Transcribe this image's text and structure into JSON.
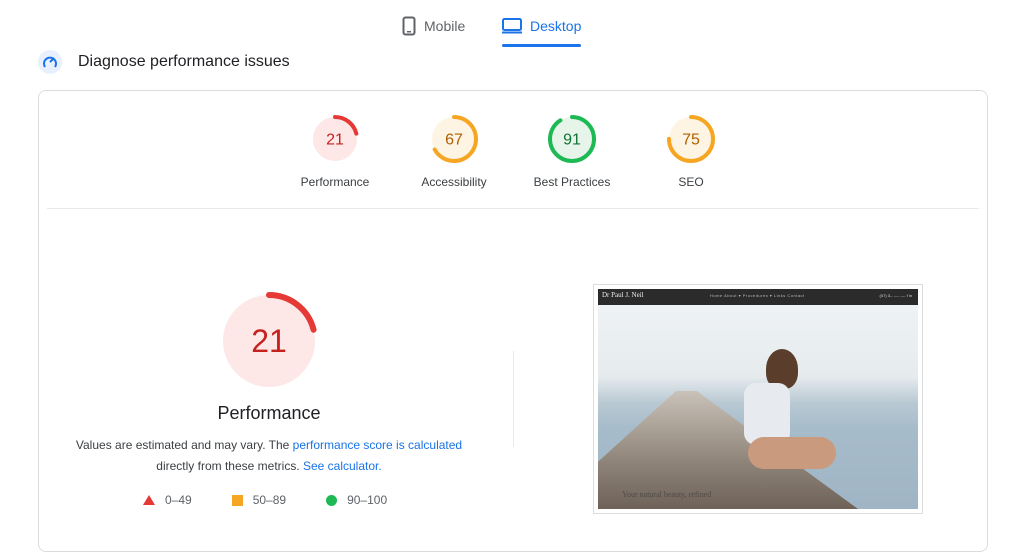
{
  "tabs": {
    "mobile_label": "Mobile",
    "desktop_label": "Desktop",
    "selected": "Desktop"
  },
  "section": {
    "title": "Diagnose performance issues"
  },
  "categories": [
    {
      "label": "Performance",
      "score": "21",
      "status": "fail",
      "color": "#e53935",
      "fill": "#fde7e7"
    },
    {
      "label": "Accessibility",
      "score": "67",
      "status": "average",
      "color": "#f6a623",
      "fill": "#fef4e3"
    },
    {
      "label": "Best Practices",
      "score": "91",
      "status": "pass",
      "color": "#1db954",
      "fill": "#e6f4ea"
    },
    {
      "label": "SEO",
      "score": "75",
      "status": "average",
      "color": "#f6a623",
      "fill": "#fef4e3"
    }
  ],
  "performance": {
    "score": "21",
    "title": "Performance",
    "desc_part1": "Values are estimated and may vary. The ",
    "desc_link1": "performance score is calculated",
    "desc_part2": "directly from these metrics. ",
    "desc_link2": "See calculator."
  },
  "legend": [
    {
      "range": "0–49",
      "shape": "triangle",
      "color": "#e53935"
    },
    {
      "range": "50–89",
      "shape": "square",
      "color": "#f6a623"
    },
    {
      "range": "90–100",
      "shape": "circle",
      "color": "#1db954"
    }
  ],
  "preview": {
    "site_logo": "Dr Paul J. Neil",
    "menu": "Home   About ▾   Procedures ▾   Links   Contact",
    "contact": "(07) 3-- ---- ---- f  in",
    "caption": "Your natural beauty, refined"
  },
  "colors": {
    "accent": "#1a73e8",
    "fail": "#e53935",
    "average": "#f6a623",
    "pass": "#1db954"
  }
}
